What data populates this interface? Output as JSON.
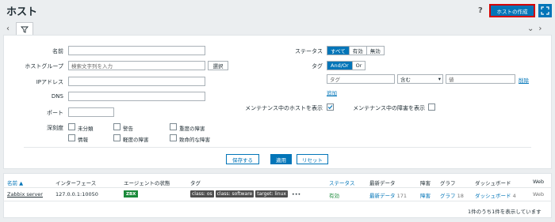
{
  "header": {
    "title": "ホスト",
    "help": "?",
    "create_button": "ホストの作成"
  },
  "filter": {
    "labels": {
      "name": "名前",
      "host_group": "ホストグループ",
      "ip": "IPアドレス",
      "dns": "DNS",
      "port": "ポート",
      "severity": "深刻度",
      "status": "ステータス",
      "tags": "タグ",
      "maint_hosts": "メンテナンス中のホストを表示",
      "maint_problems": "メンテナンス中の障害を表示"
    },
    "host_group_placeholder": "検索文字列を入力",
    "select_button": "選択",
    "status_options": [
      "すべて",
      "有効",
      "無効"
    ],
    "tag_ops": [
      "And/Or",
      "Or"
    ],
    "tag_placeholder": "タグ",
    "tag_operator": "含む",
    "tag_value_placeholder": "値",
    "remove_link": "削除",
    "add_link": "追加",
    "severities": [
      "未分類",
      "警告",
      "重度の障害",
      "情報",
      "軽度の障害",
      "致命的な障害"
    ],
    "save_as": "保存する",
    "apply": "適用",
    "reset": "リセット"
  },
  "table": {
    "headers": {
      "name": "名前 ▲",
      "interface": "インターフェース",
      "agent": "エージェントの状態",
      "tags": "タグ",
      "status": "ステータス",
      "latest": "最新データ",
      "problems": "障害",
      "graphs": "グラフ",
      "dashboards": "ダッシュボード",
      "web": "Web"
    },
    "row": {
      "name": "Zabbix server",
      "interface": "127.0.0.1:10050",
      "agent": "ZBX",
      "tags": [
        "class: os",
        "class: software",
        "target: linux"
      ],
      "more": "•••",
      "status": "有効",
      "latest": "最新データ",
      "latest_count": "171",
      "problems": "障害",
      "graphs": "グラフ",
      "graphs_count": "18",
      "dashboards": "ダッシュボード",
      "dashboards_count": "4",
      "web": "Web"
    },
    "footer": "1件のうち1件を表示しています"
  }
}
